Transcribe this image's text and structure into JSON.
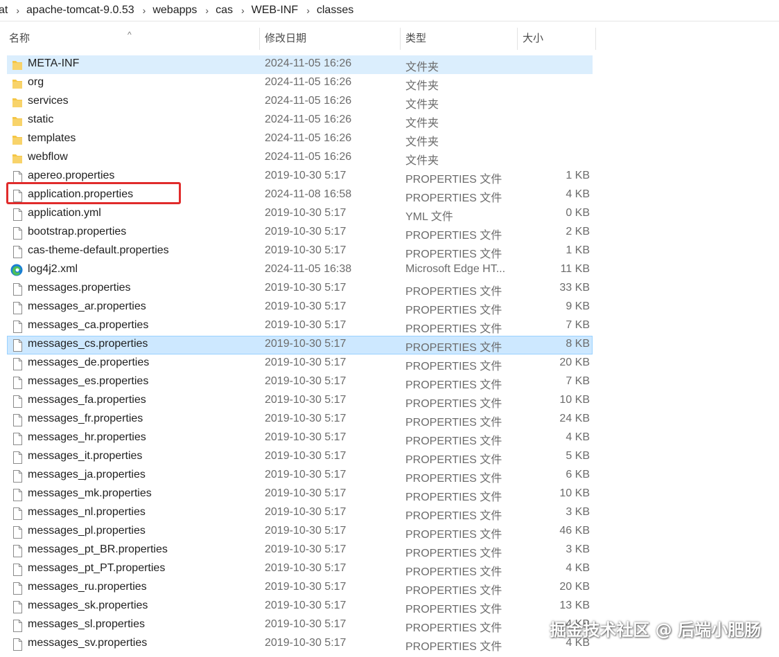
{
  "breadcrumb": [
    "at",
    "apache-tomcat-9.0.53",
    "webapps",
    "cas",
    "WEB-INF",
    "classes"
  ],
  "columns": {
    "name": "名称",
    "date": "修改日期",
    "type": "类型",
    "size": "大小"
  },
  "colors": {
    "selection": "#cde8ff",
    "hover": "#dbeefd",
    "highlight_box": "#e02b2b",
    "folder": "#f5c645"
  },
  "rows": [
    {
      "name": "META-INF",
      "date": "2024-11-05 16:26",
      "type": "文件夹",
      "size": "",
      "icon": "folder-icon"
    },
    {
      "name": "org",
      "date": "2024-11-05 16:26",
      "type": "文件夹",
      "size": "",
      "icon": "folder-icon"
    },
    {
      "name": "services",
      "date": "2024-11-05 16:26",
      "type": "文件夹",
      "size": "",
      "icon": "folder-icon"
    },
    {
      "name": "static",
      "date": "2024-11-05 16:26",
      "type": "文件夹",
      "size": "",
      "icon": "folder-icon"
    },
    {
      "name": "templates",
      "date": "2024-11-05 16:26",
      "type": "文件夹",
      "size": "",
      "icon": "folder-icon"
    },
    {
      "name": "webflow",
      "date": "2024-11-05 16:26",
      "type": "文件夹",
      "size": "",
      "icon": "folder-icon"
    },
    {
      "name": "apereo.properties",
      "date": "2019-10-30 5:17",
      "type": "PROPERTIES 文件",
      "size": "1 KB",
      "icon": "file-icon"
    },
    {
      "name": "application.properties",
      "date": "2024-11-08 16:58",
      "type": "PROPERTIES 文件",
      "size": "4 KB",
      "icon": "file-icon"
    },
    {
      "name": "application.yml",
      "date": "2019-10-30 5:17",
      "type": "YML 文件",
      "size": "0 KB",
      "icon": "file-icon"
    },
    {
      "name": "bootstrap.properties",
      "date": "2019-10-30 5:17",
      "type": "PROPERTIES 文件",
      "size": "2 KB",
      "icon": "file-icon"
    },
    {
      "name": "cas-theme-default.properties",
      "date": "2019-10-30 5:17",
      "type": "PROPERTIES 文件",
      "size": "1 KB",
      "icon": "file-icon"
    },
    {
      "name": "log4j2.xml",
      "date": "2024-11-05 16:38",
      "type": "Microsoft Edge HT...",
      "size": "11 KB",
      "icon": "edge-icon"
    },
    {
      "name": "messages.properties",
      "date": "2019-10-30 5:17",
      "type": "PROPERTIES 文件",
      "size": "33 KB",
      "icon": "file-icon"
    },
    {
      "name": "messages_ar.properties",
      "date": "2019-10-30 5:17",
      "type": "PROPERTIES 文件",
      "size": "9 KB",
      "icon": "file-icon"
    },
    {
      "name": "messages_ca.properties",
      "date": "2019-10-30 5:17",
      "type": "PROPERTIES 文件",
      "size": "7 KB",
      "icon": "file-icon"
    },
    {
      "name": "messages_cs.properties",
      "date": "2019-10-30 5:17",
      "type": "PROPERTIES 文件",
      "size": "8 KB",
      "icon": "file-icon"
    },
    {
      "name": "messages_de.properties",
      "date": "2019-10-30 5:17",
      "type": "PROPERTIES 文件",
      "size": "20 KB",
      "icon": "file-icon"
    },
    {
      "name": "messages_es.properties",
      "date": "2019-10-30 5:17",
      "type": "PROPERTIES 文件",
      "size": "7 KB",
      "icon": "file-icon"
    },
    {
      "name": "messages_fa.properties",
      "date": "2019-10-30 5:17",
      "type": "PROPERTIES 文件",
      "size": "10 KB",
      "icon": "file-icon"
    },
    {
      "name": "messages_fr.properties",
      "date": "2019-10-30 5:17",
      "type": "PROPERTIES 文件",
      "size": "24 KB",
      "icon": "file-icon"
    },
    {
      "name": "messages_hr.properties",
      "date": "2019-10-30 5:17",
      "type": "PROPERTIES 文件",
      "size": "4 KB",
      "icon": "file-icon"
    },
    {
      "name": "messages_it.properties",
      "date": "2019-10-30 5:17",
      "type": "PROPERTIES 文件",
      "size": "5 KB",
      "icon": "file-icon"
    },
    {
      "name": "messages_ja.properties",
      "date": "2019-10-30 5:17",
      "type": "PROPERTIES 文件",
      "size": "6 KB",
      "icon": "file-icon"
    },
    {
      "name": "messages_mk.properties",
      "date": "2019-10-30 5:17",
      "type": "PROPERTIES 文件",
      "size": "10 KB",
      "icon": "file-icon"
    },
    {
      "name": "messages_nl.properties",
      "date": "2019-10-30 5:17",
      "type": "PROPERTIES 文件",
      "size": "3 KB",
      "icon": "file-icon"
    },
    {
      "name": "messages_pl.properties",
      "date": "2019-10-30 5:17",
      "type": "PROPERTIES 文件",
      "size": "46 KB",
      "icon": "file-icon"
    },
    {
      "name": "messages_pt_BR.properties",
      "date": "2019-10-30 5:17",
      "type": "PROPERTIES 文件",
      "size": "3 KB",
      "icon": "file-icon"
    },
    {
      "name": "messages_pt_PT.properties",
      "date": "2019-10-30 5:17",
      "type": "PROPERTIES 文件",
      "size": "4 KB",
      "icon": "file-icon"
    },
    {
      "name": "messages_ru.properties",
      "date": "2019-10-30 5:17",
      "type": "PROPERTIES 文件",
      "size": "20 KB",
      "icon": "file-icon"
    },
    {
      "name": "messages_sk.properties",
      "date": "2019-10-30 5:17",
      "type": "PROPERTIES 文件",
      "size": "13 KB",
      "icon": "file-icon"
    },
    {
      "name": "messages_sl.properties",
      "date": "2019-10-30 5:17",
      "type": "PROPERTIES 文件",
      "size": "4 KB",
      "icon": "file-icon"
    },
    {
      "name": "messages_sv.properties",
      "date": "2019-10-30 5:17",
      "type": "PROPERTIES 文件",
      "size": "4 KB",
      "icon": "file-icon"
    }
  ],
  "hovered_row": 0,
  "selected_row": 15,
  "annotated_row": 7,
  "watermark": "掘金技术社区 @ 后端小肥肠"
}
